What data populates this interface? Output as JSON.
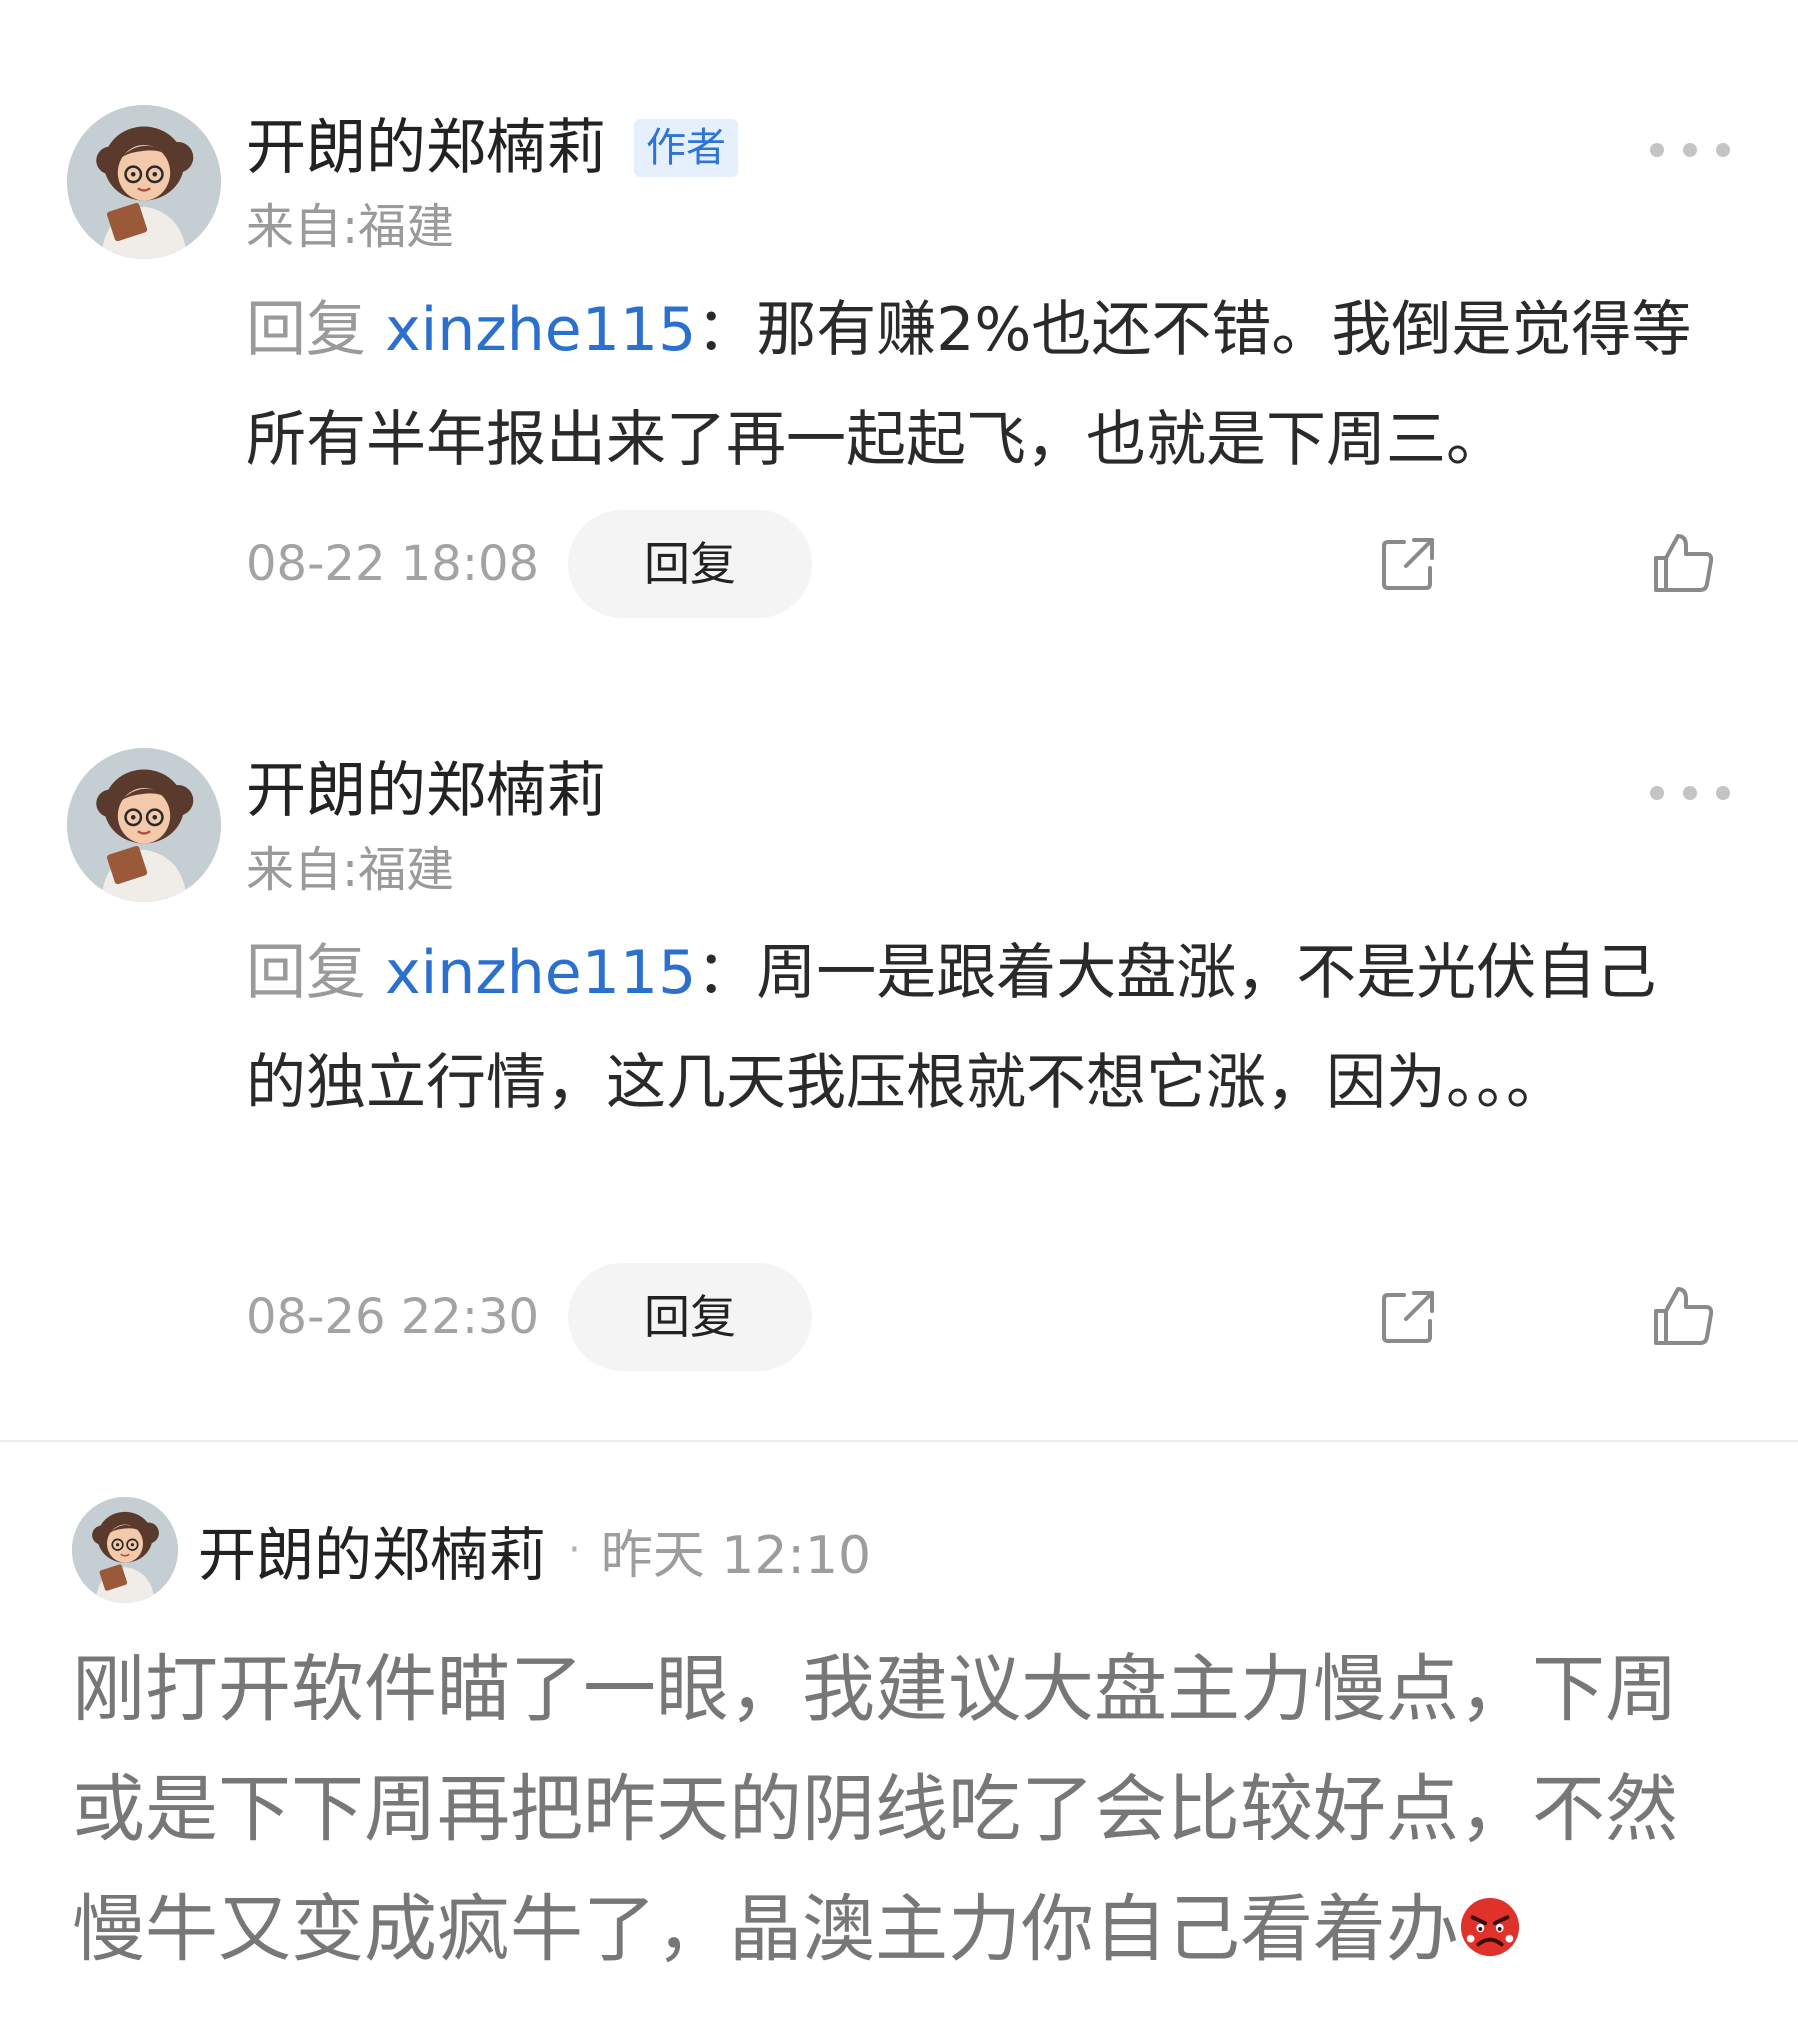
{
  "replies": [
    {
      "user": "开朗的郑楠莉",
      "badge": "作者",
      "location": "来自:福建",
      "reply_prefix": "回复",
      "mention": "xinzhe115",
      "text": "：那有赚2%也还不错。我倒是觉得等所有半年报出来了再一起起飞，也就是下周三。",
      "time": "08-22 18:08",
      "reply_button": "回复",
      "more_icon": "more-dots-icon",
      "share_icon": "share-icon",
      "like_icon": "thumbs-up-icon"
    },
    {
      "user": "开朗的郑楠莉",
      "location": "来自:福建",
      "reply_prefix": "回复",
      "mention": "xinzhe115",
      "text": "：周一是跟着大盘涨，不是光伏自己的独立行情，这几天我压根就不想它涨，因为。。。",
      "time": "08-26 22:30",
      "reply_button": "回复",
      "more_icon": "more-dots-icon",
      "share_icon": "share-icon",
      "like_icon": "thumbs-up-icon"
    }
  ],
  "post": {
    "user": "开朗的郑楠莉",
    "separator": "·",
    "time": "昨天 12:10",
    "text": "刚打开软件瞄了一眼，我建议大盘主力慢点，下周或是下下周再把昨天的阴线吃了会比较好点，不然慢牛又变成疯牛了，晶澳主力你自己看着办",
    "emoji": "angry-face-emoji"
  },
  "colors": {
    "mention": "#2b6fcf",
    "badge_bg": "#e6f0fd",
    "badge_text": "#2d74d6",
    "muted_text": "#9a9a9a",
    "pill_bg": "#f4f4f5"
  }
}
